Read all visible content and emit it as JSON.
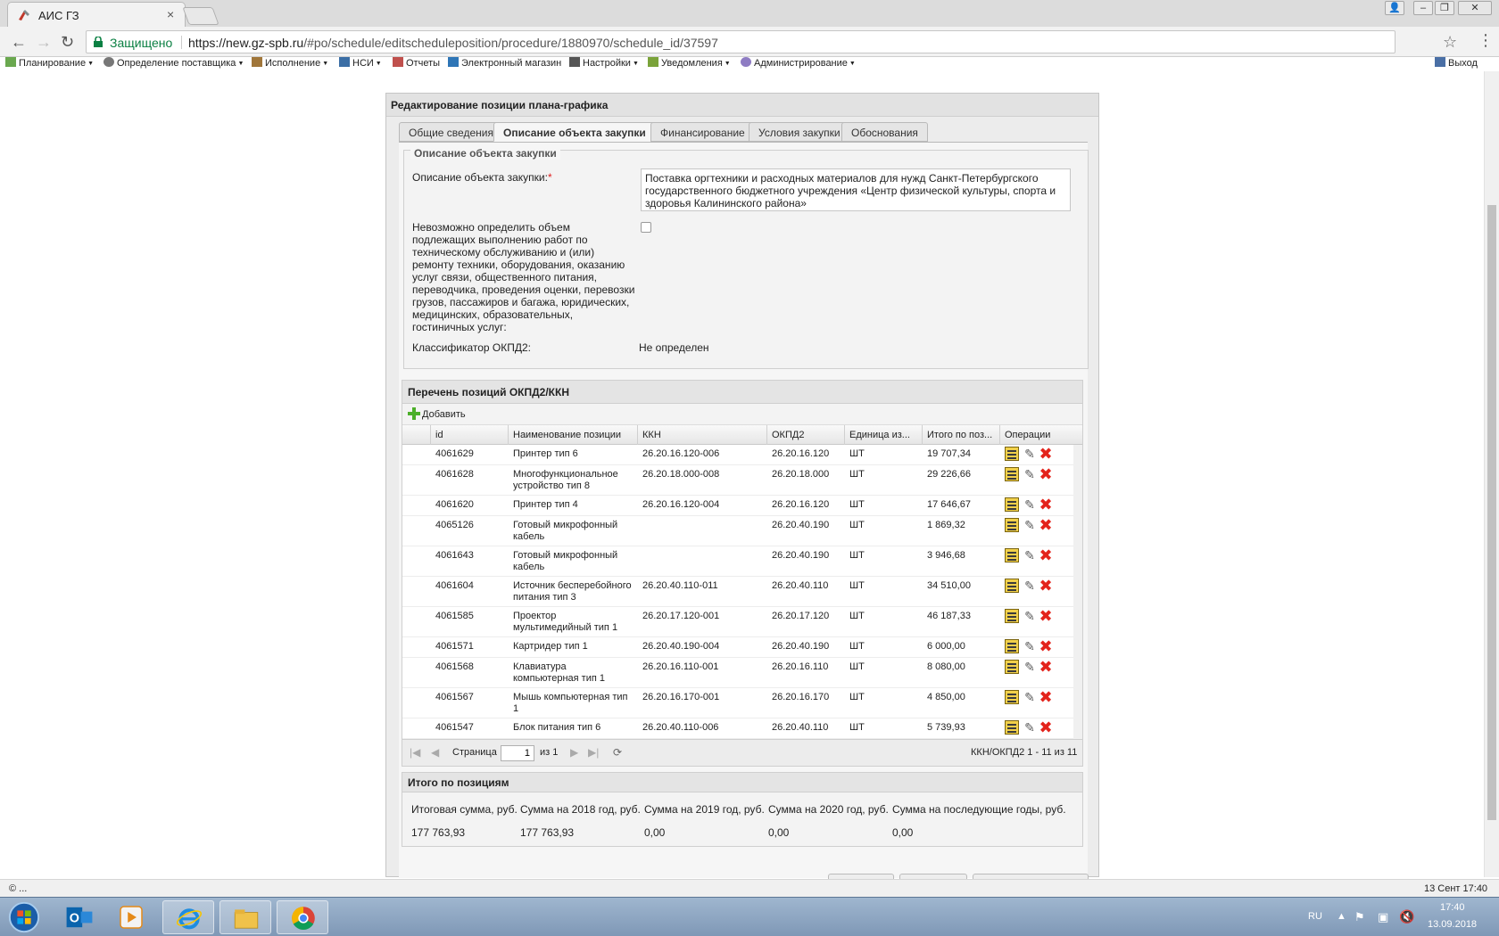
{
  "browser": {
    "tab_title": "АИС ГЗ",
    "tab_close": "×",
    "secure_label": "Защищено",
    "url_host": "https://new.gz-spb.ru",
    "url_path": "/#po/schedule/editscheduleposition/procedure/1880970/schedule_id/37597",
    "star": "☆",
    "more": "⋮",
    "back": "←",
    "forward": "→",
    "reload": "↻",
    "win_user": "👤",
    "win_min": "–",
    "win_max": "❐",
    "win_close": "✕"
  },
  "menu": {
    "items": [
      "Планирование",
      "Определение поставщика",
      "Исполнение",
      "НСИ",
      "Отчеты",
      "Электронный магазин",
      "Настройки",
      "Уведомления",
      "Администрирование"
    ],
    "exit": "Выход"
  },
  "panel": {
    "title": "Редактирование позиции плана-графика",
    "tabs": [
      "Общие сведения",
      "Описание объекта закупки",
      "Финансирование",
      "Условия закупки",
      "Обоснования"
    ],
    "active_tab": 1
  },
  "form": {
    "legend": "Описание объекта закупки",
    "desc_label": "Описание объекта закупки:",
    "required_mark": "*",
    "desc_value": "Поставка оргтехники и расходных материалов для нужд Санкт-Петербургского государственного бюджетного учреждения «Центр физической культуры, спорта и здоровья Калининского района»",
    "checkbox_label": "Невозможно определить объем подлежащих выполнению работ по техническому обслуживанию и (или) ремонту техники, оборудования, оказанию услуг связи, общественного питания, переводчика, проведения оценки, перевозки грузов, пассажиров и багажа, юридических, медицинских, образовательных, гостиничных услуг:",
    "checkbox_checked": false,
    "okpd_label": "Классификатор ОКПД2:",
    "okpd_value": "Не определен"
  },
  "grid": {
    "title": "Перечень позиций ОКПД2/ККН",
    "add_label": "Добавить",
    "columns": [
      "id",
      "Наименование позиции",
      "ККН",
      "ОКПД2",
      "Единица из...",
      "Итого по поз...",
      "Операции"
    ],
    "rows": [
      {
        "id": "4061629",
        "name": "Принтер тип 6",
        "kkn": "26.20.16.120-006",
        "okpd": "26.20.16.120",
        "unit": "ШТ",
        "total": "19 707,34"
      },
      {
        "id": "4061628",
        "name": "Многофункциональное устройство тип 8",
        "kkn": "26.20.18.000-008",
        "okpd": "26.20.18.000",
        "unit": "ШТ",
        "total": "29 226,66"
      },
      {
        "id": "4061620",
        "name": "Принтер тип 4",
        "kkn": "26.20.16.120-004",
        "okpd": "26.20.16.120",
        "unit": "ШТ",
        "total": "17 646,67"
      },
      {
        "id": "4065126",
        "name": "Готовый микрофонный кабель",
        "kkn": "",
        "okpd": "26.20.40.190",
        "unit": "ШТ",
        "total": "1 869,32"
      },
      {
        "id": "4061643",
        "name": "Готовый микрофонный кабель",
        "kkn": "",
        "okpd": "26.20.40.190",
        "unit": "ШТ",
        "total": "3 946,68"
      },
      {
        "id": "4061604",
        "name": "Источник бесперебойного питания тип 3",
        "kkn": "26.20.40.110-011",
        "okpd": "26.20.40.110",
        "unit": "ШТ",
        "total": "34 510,00"
      },
      {
        "id": "4061585",
        "name": "Проектор мультимедийный тип 1",
        "kkn": "26.20.17.120-001",
        "okpd": "26.20.17.120",
        "unit": "ШТ",
        "total": "46 187,33"
      },
      {
        "id": "4061571",
        "name": "Картридер тип 1",
        "kkn": "26.20.40.190-004",
        "okpd": "26.20.40.190",
        "unit": "ШТ",
        "total": "6 000,00"
      },
      {
        "id": "4061568",
        "name": "Клавиатура компьютерная тип 1",
        "kkn": "26.20.16.110-001",
        "okpd": "26.20.16.110",
        "unit": "ШТ",
        "total": "8 080,00"
      },
      {
        "id": "4061567",
        "name": "Мышь компьютерная тип 1",
        "kkn": "26.20.16.170-001",
        "okpd": "26.20.16.170",
        "unit": "ШТ",
        "total": "4 850,00"
      },
      {
        "id": "4061547",
        "name": "Блок питания тип 6",
        "kkn": "26.20.40.110-006",
        "okpd": "26.20.40.110",
        "unit": "ШТ",
        "total": "5 739,93"
      }
    ],
    "pager": {
      "page_label": "Страница",
      "page_value": "1",
      "of_label": "из 1",
      "summary": "ККН/ОКПД2 1 - 11 из 11"
    }
  },
  "totals": {
    "title": "Итого по позициям",
    "headers": [
      "Итоговая сумма, руб.",
      "Сумма на 2018 год, руб.",
      "Сумма на 2019 год, руб.",
      "Сумма на 2020 год, руб.",
      "Сумма на последующие годы, руб."
    ],
    "values": [
      "177 763,93",
      "177 763,93",
      "0,00",
      "0,00",
      "0,00"
    ]
  },
  "statusbar": {
    "left": "© ...",
    "right": "13 Сент 17:40"
  },
  "taskbar": {
    "lang": "RU",
    "time": "17:40",
    "date": "13.09.2018"
  },
  "colors": {
    "secure_green": "#0b8043",
    "required_red": "#e02020",
    "delete_red": "#e3231b",
    "add_green": "#4caf2a"
  }
}
